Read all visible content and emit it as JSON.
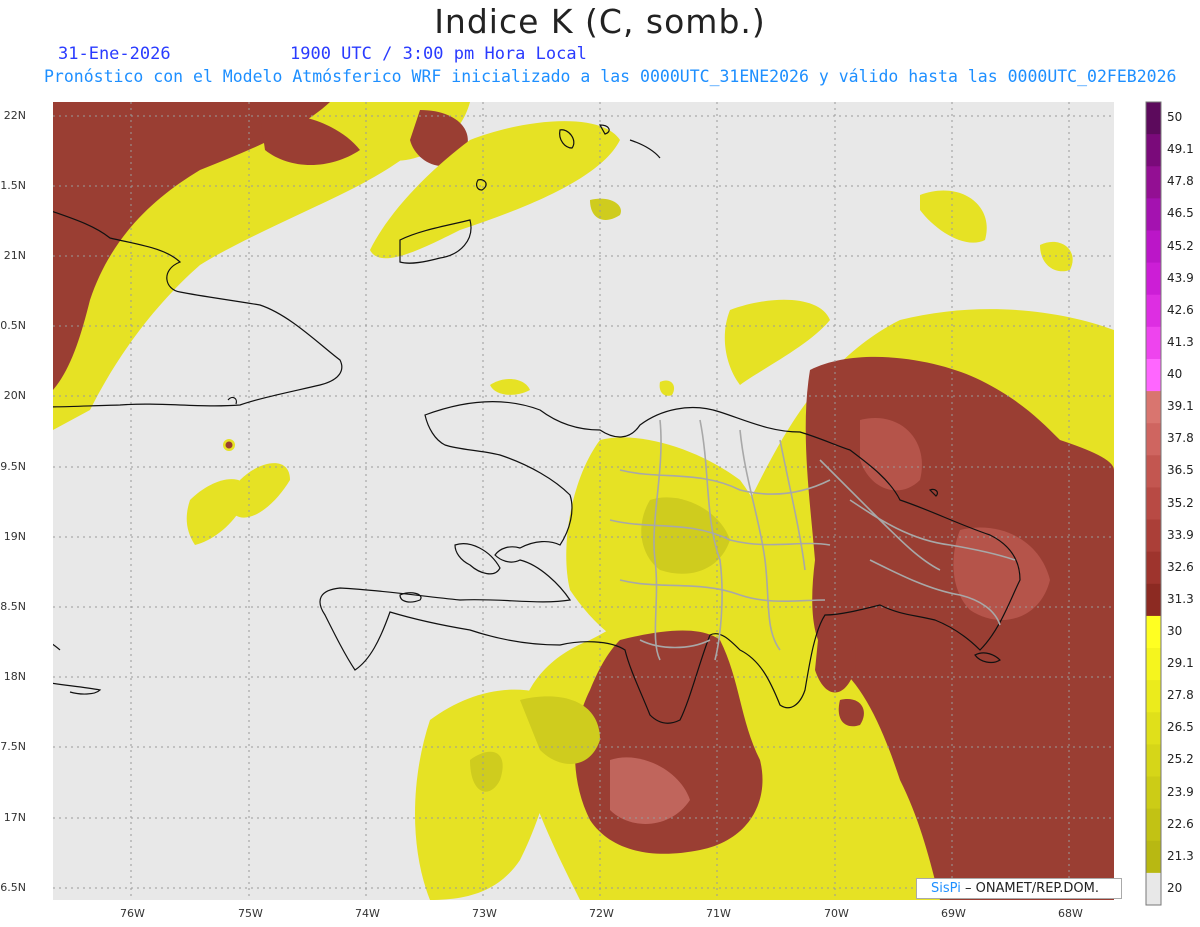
{
  "title": "Indice K (C, somb.)",
  "subtitle_date": "31-Ene-2026",
  "subtitle_time": "1900 UTC / 3:00 pm Hora Local",
  "subtitle_model": "Pronóstico con el Modelo Atmósferico WRF inicializado a las 0000UTC_31ENE2026 y válido hasta las  0000UTC_02FEB2026",
  "lat_labels": [
    "22N",
    "1.5N",
    "21N",
    "0.5N",
    "20N",
    "9.5N",
    "19N",
    "8.5N",
    "18N",
    "7.5N",
    "17N",
    "6.5N"
  ],
  "lon_labels": [
    "76W",
    "75W",
    "74W",
    "73W",
    "72W",
    "71W",
    "70W",
    "69W",
    "68W"
  ],
  "colorbar": {
    "labels": [
      "50",
      "49.1",
      "47.8",
      "46.5",
      "45.2",
      "43.9",
      "42.6",
      "41.3",
      "40",
      "39.1",
      "37.8",
      "36.5",
      "35.2",
      "33.9",
      "32.6",
      "31.3",
      "30",
      "29.1",
      "27.8",
      "26.5",
      "25.2",
      "23.9",
      "22.6",
      "21.3",
      "20"
    ],
    "colors": [
      "#5c0a5c",
      "#7a0a7a",
      "#930f93",
      "#a412b0",
      "#bb16c8",
      "#cc1ed6",
      "#dd2ee2",
      "#ee44ee",
      "#ff66ff",
      "#d9756f",
      "#cf6560",
      "#c35650",
      "#b84a44",
      "#ab3f38",
      "#9e342d",
      "#8c2a22",
      "#ffff22",
      "#f5f51e",
      "#ebeb1c",
      "#e0e01a",
      "#d6d618",
      "#cccc16",
      "#c2c214",
      "#b8b812",
      "#e8e8e8"
    ]
  },
  "palette": {
    "background": "#e8e8e8",
    "yellow": "#e6e224",
    "olive": "#cfcc1e",
    "brown": "#9a3e33",
    "brown_light": "#b5544a",
    "pink": "#d9837c",
    "border": "#a8a8a8"
  },
  "credit": {
    "brand": "SisPi",
    "text": "– ONAMET/REP.DOM."
  }
}
